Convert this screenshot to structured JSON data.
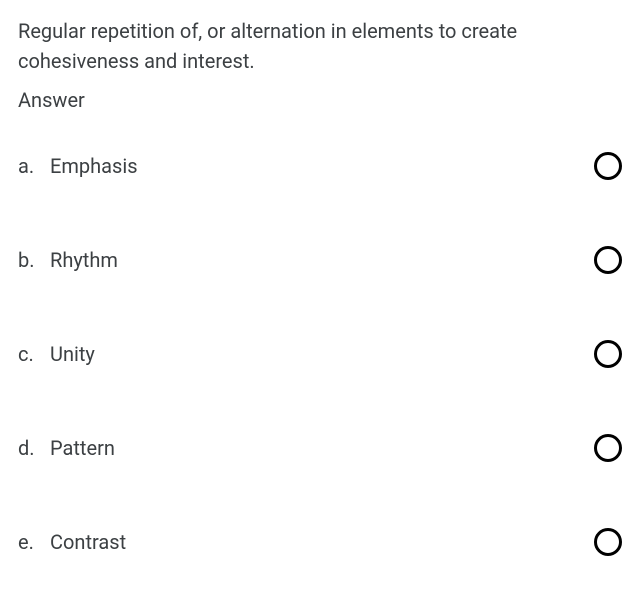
{
  "question": {
    "text": "Regular repetition of, or alternation in elements to create cohesiveness and interest.",
    "answer_label": "Answer"
  },
  "options": [
    {
      "letter": "a.",
      "label": "Emphasis"
    },
    {
      "letter": "b.",
      "label": "Rhythm"
    },
    {
      "letter": "c.",
      "label": "Unity"
    },
    {
      "letter": "d.",
      "label": "Pattern"
    },
    {
      "letter": "e.",
      "label": "Contrast"
    }
  ]
}
